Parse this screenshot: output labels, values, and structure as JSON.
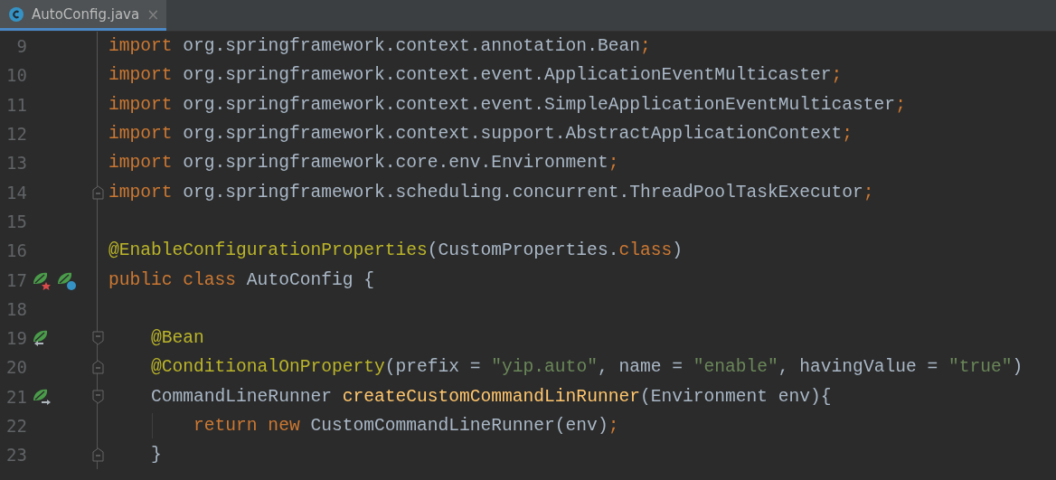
{
  "tabs": [
    {
      "label": "AutoConfig.java",
      "selected": true,
      "close": "×"
    }
  ],
  "editor": {
    "lines": [
      {
        "number": "9",
        "tokens": [
          {
            "kind": "keyword",
            "text": "import"
          },
          {
            "kind": "plain",
            "text": " org.springframework.context.annotation.Bean"
          },
          {
            "kind": "keyword",
            "text": ";"
          }
        ]
      },
      {
        "number": "10",
        "tokens": [
          {
            "kind": "keyword",
            "text": "import"
          },
          {
            "kind": "plain",
            "text": " org.springframework.context.event.ApplicationEventMulticaster"
          },
          {
            "kind": "keyword",
            "text": ";"
          }
        ]
      },
      {
        "number": "11",
        "tokens": [
          {
            "kind": "keyword",
            "text": "import"
          },
          {
            "kind": "plain",
            "text": " org.springframework.context.event.SimpleApplicationEventMulticaster"
          },
          {
            "kind": "keyword",
            "text": ";"
          }
        ]
      },
      {
        "number": "12",
        "tokens": [
          {
            "kind": "keyword",
            "text": "import"
          },
          {
            "kind": "plain",
            "text": " org.springframework.context.support.AbstractApplicationContext"
          },
          {
            "kind": "keyword",
            "text": ";"
          }
        ]
      },
      {
        "number": "13",
        "tokens": [
          {
            "kind": "keyword",
            "text": "import"
          },
          {
            "kind": "plain",
            "text": " org.springframework.core.env.Environment"
          },
          {
            "kind": "keyword",
            "text": ";"
          }
        ]
      },
      {
        "number": "14",
        "fold_marker": {
          "kind": "end"
        },
        "tokens": [
          {
            "kind": "keyword",
            "text": "import"
          },
          {
            "kind": "plain",
            "text": " org.springframework.scheduling.concurrent.ThreadPoolTaskExecutor"
          },
          {
            "kind": "keyword",
            "text": ";"
          }
        ]
      },
      {
        "number": "15"
      },
      {
        "number": "16",
        "tokens": [
          {
            "kind": "annotation",
            "text": "@EnableConfigurationProperties"
          },
          {
            "kind": "plain",
            "text": "(CustomProperties."
          },
          {
            "kind": "keyword",
            "text": "class"
          },
          {
            "kind": "plain",
            "text": ")"
          }
        ]
      },
      {
        "number": "17",
        "icons": [
          {
            "kind": "bean-star"
          },
          {
            "kind": "bean-c"
          }
        ],
        "tokens": [
          {
            "kind": "keyword",
            "text": "public class "
          },
          {
            "kind": "plain",
            "text": "AutoConfig {"
          }
        ]
      },
      {
        "number": "18"
      },
      {
        "number": "19",
        "icons": [
          {
            "kind": "bean-left"
          }
        ],
        "fold_marker": {
          "kind": "start"
        },
        "tokens": [
          {
            "kind": "annotation",
            "text": "    @Bean"
          }
        ]
      },
      {
        "number": "20",
        "fold_marker": {
          "kind": "end"
        },
        "tokens": [
          {
            "kind": "annotation",
            "text": "    @ConditionalOnProperty"
          },
          {
            "kind": "plain",
            "text": "(prefix = "
          },
          {
            "kind": "string",
            "text": "\"yip.auto\""
          },
          {
            "kind": "plain",
            "text": ", name = "
          },
          {
            "kind": "string",
            "text": "\"enable\""
          },
          {
            "kind": "plain",
            "text": ", havingValue = "
          },
          {
            "kind": "string",
            "text": "\"true\""
          },
          {
            "kind": "plain",
            "text": ")"
          }
        ]
      },
      {
        "number": "21",
        "icons": [
          {
            "kind": "bean-right"
          }
        ],
        "fold_marker": {
          "kind": "start"
        },
        "tokens": [
          {
            "kind": "plain",
            "text": "    CommandLineRunner "
          },
          {
            "kind": "method",
            "text": "createCustomCommandLinRunner"
          },
          {
            "kind": "plain",
            "text": "(Environment env){"
          }
        ]
      },
      {
        "number": "22",
        "guide": true,
        "tokens": [
          {
            "kind": "keyword",
            "text": "        return new "
          },
          {
            "kind": "plain",
            "text": "CustomCommandLineRunner(env)"
          },
          {
            "kind": "keyword",
            "text": ";"
          }
        ]
      },
      {
        "number": "23",
        "fold_marker": {
          "kind": "end"
        },
        "tokens": [
          {
            "kind": "plain",
            "text": "    }"
          }
        ]
      }
    ]
  }
}
